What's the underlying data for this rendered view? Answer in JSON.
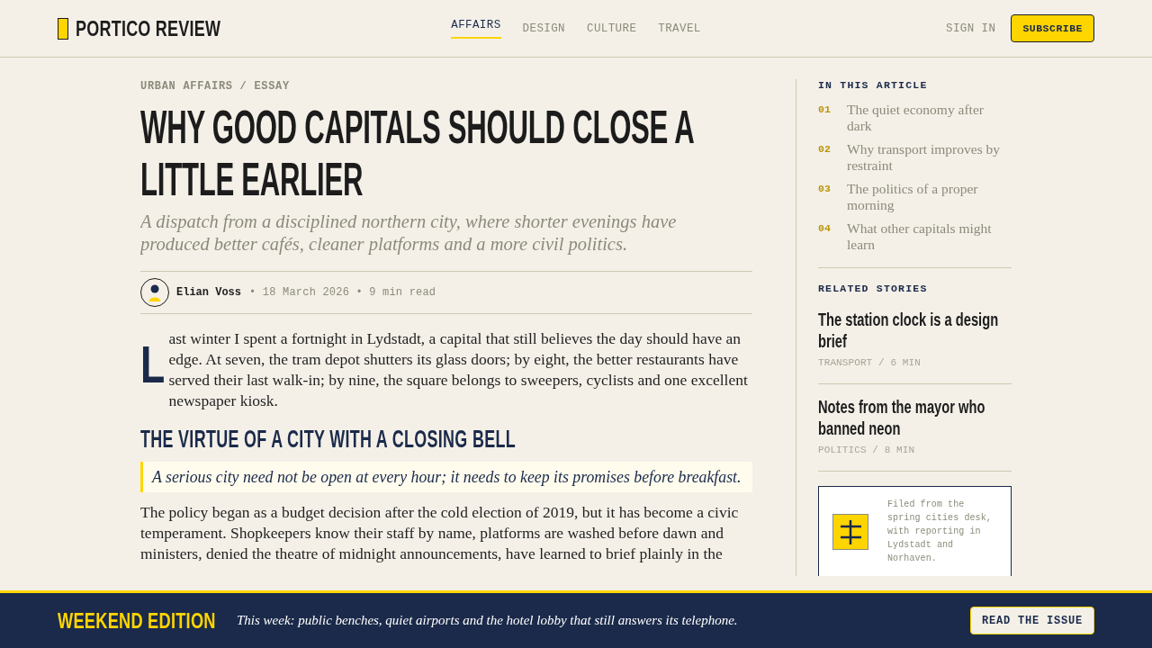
{
  "header": {
    "logo": "PORTICO REVIEW",
    "nav": [
      {
        "label": "AFFAIRS",
        "selected": true
      },
      {
        "label": "DESIGN",
        "selected": false
      },
      {
        "label": "CULTURE",
        "selected": false
      },
      {
        "label": "TRAVEL",
        "selected": false
      }
    ],
    "sign_in": "SIGN IN",
    "subscribe": "SUBSCRIBE"
  },
  "article": {
    "kicker": "URBAN AFFAIRS / ESSAY",
    "title": "WHY GOOD CAPITALS SHOULD CLOSE A LITTLE EARLIER",
    "deck": "A dispatch from a disciplined northern city, where shorter evenings have produced better cafés, cleaner platforms and a more civil politics.",
    "byline": {
      "author": "Elian Voss",
      "details": "• 18 March 2026 • 9 min read"
    },
    "body": [
      {
        "kind": "dropcap_paragraph",
        "drop_cap": "L",
        "text": "ast winter I spent a fortnight in Lydstadt, a capital that still believes the day should have an edge. At seven, the tram depot shutters its glass doors; by eight, the better restaurants have served their last walk-in; by nine, the square belongs to sweepers, cyclists and one excellent newspaper kiosk."
      },
      {
        "kind": "heading",
        "text": "THE VIRTUE OF A CITY WITH A CLOSING BELL"
      },
      {
        "kind": "pullquote",
        "text": "A serious city need not be open at every hour; it needs to keep its promises before breakfast."
      },
      {
        "kind": "paragraph",
        "text": "The policy began as a budget decision after the cold election of 2019, but it has become a civic temperament. Shopkeepers know their staff by name, platforms are washed before dawn and ministers, denied the theatre of midnight announcements, have learned to brief plainly in the"
      }
    ]
  },
  "sidebar": {
    "toc": {
      "heading": "IN THIS ARTICLE",
      "items": [
        {
          "number": "01",
          "text": "The quiet economy after dark"
        },
        {
          "number": "02",
          "text": "Why transport improves by restraint"
        },
        {
          "number": "03",
          "text": "The politics of a proper morning"
        },
        {
          "number": "04",
          "text": "What other capitals might learn"
        }
      ]
    },
    "related": {
      "heading": "RELATED STORIES",
      "items": [
        {
          "title": "The station clock is a design brief",
          "meta": "TRANSPORT / 6 MIN"
        },
        {
          "title": "Notes from the mayor who banned neon",
          "meta": "POLITICS / 8 MIN"
        }
      ]
    },
    "desk_note": {
      "text": "Filed from the spring cities desk, with reporting in Lydstadt and Norhaven."
    }
  },
  "banner": {
    "label": "WEEKEND EDITION",
    "text": "This week: public benches, quiet airports and the hotel lobby that still answers its telephone.",
    "button": "READ THE ISSUE"
  }
}
